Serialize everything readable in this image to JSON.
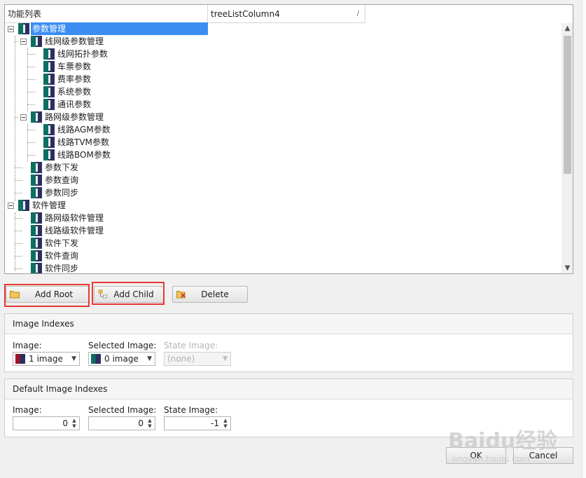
{
  "tree": {
    "columns": [
      "功能列表",
      "treeListColumn4"
    ],
    "nodes": [
      {
        "label": "参数管理",
        "level": 0,
        "expanded": true,
        "selected": true
      },
      {
        "label": "线网级参数管理",
        "level": 1,
        "expanded": true
      },
      {
        "label": "线网拓扑参数",
        "level": 2
      },
      {
        "label": "车票参数",
        "level": 2
      },
      {
        "label": "费率参数",
        "level": 2
      },
      {
        "label": "系统参数",
        "level": 2
      },
      {
        "label": "通讯参数",
        "level": 2
      },
      {
        "label": "路网级参数管理",
        "level": 1,
        "expanded": true
      },
      {
        "label": "线路AGM参数",
        "level": 2
      },
      {
        "label": "线路TVM参数",
        "level": 2
      },
      {
        "label": "线路BOM参数",
        "level": 2
      },
      {
        "label": "参数下发",
        "level": 1
      },
      {
        "label": "参数查询",
        "level": 1
      },
      {
        "label": "参数同步",
        "level": 1
      },
      {
        "label": "软件管理",
        "level": 0,
        "expanded": true
      },
      {
        "label": "路网级软件管理",
        "level": 1
      },
      {
        "label": "线路级软件管理",
        "level": 1
      },
      {
        "label": "软件下发",
        "level": 1
      },
      {
        "label": "软件查询",
        "level": 1
      },
      {
        "label": "软件同步",
        "level": 1
      }
    ]
  },
  "buttons": {
    "add_root": "Add Root",
    "add_child": "Add Child",
    "delete": "Delete",
    "ok": "OK",
    "cancel": "Cancel"
  },
  "image_indexes": {
    "title": "Image Indexes",
    "image_label": "Image:",
    "image_value": "1 image",
    "selected_label": "Selected Image:",
    "selected_value": "0 image",
    "state_label": "State Image:",
    "state_value": "(none)"
  },
  "default_image_indexes": {
    "title": "Default Image Indexes",
    "image_label": "Image:",
    "image_value": "0",
    "selected_label": "Selected Image:",
    "selected_value": "0",
    "state_label": "State Image:",
    "state_value": "-1"
  },
  "watermark": {
    "logo": "Baidu经验",
    "url": "jingyan.baidu.com"
  },
  "colors": {
    "selection": "#3b8df1",
    "highlight_box": "#e53935",
    "icon_teal": "#0d6f62",
    "icon_navy": "#2c2f5e"
  },
  "icons": {
    "add_root": "folder-icon",
    "add_child": "tree-child-icon",
    "delete": "delete-icon",
    "node": "node-image-icon"
  }
}
